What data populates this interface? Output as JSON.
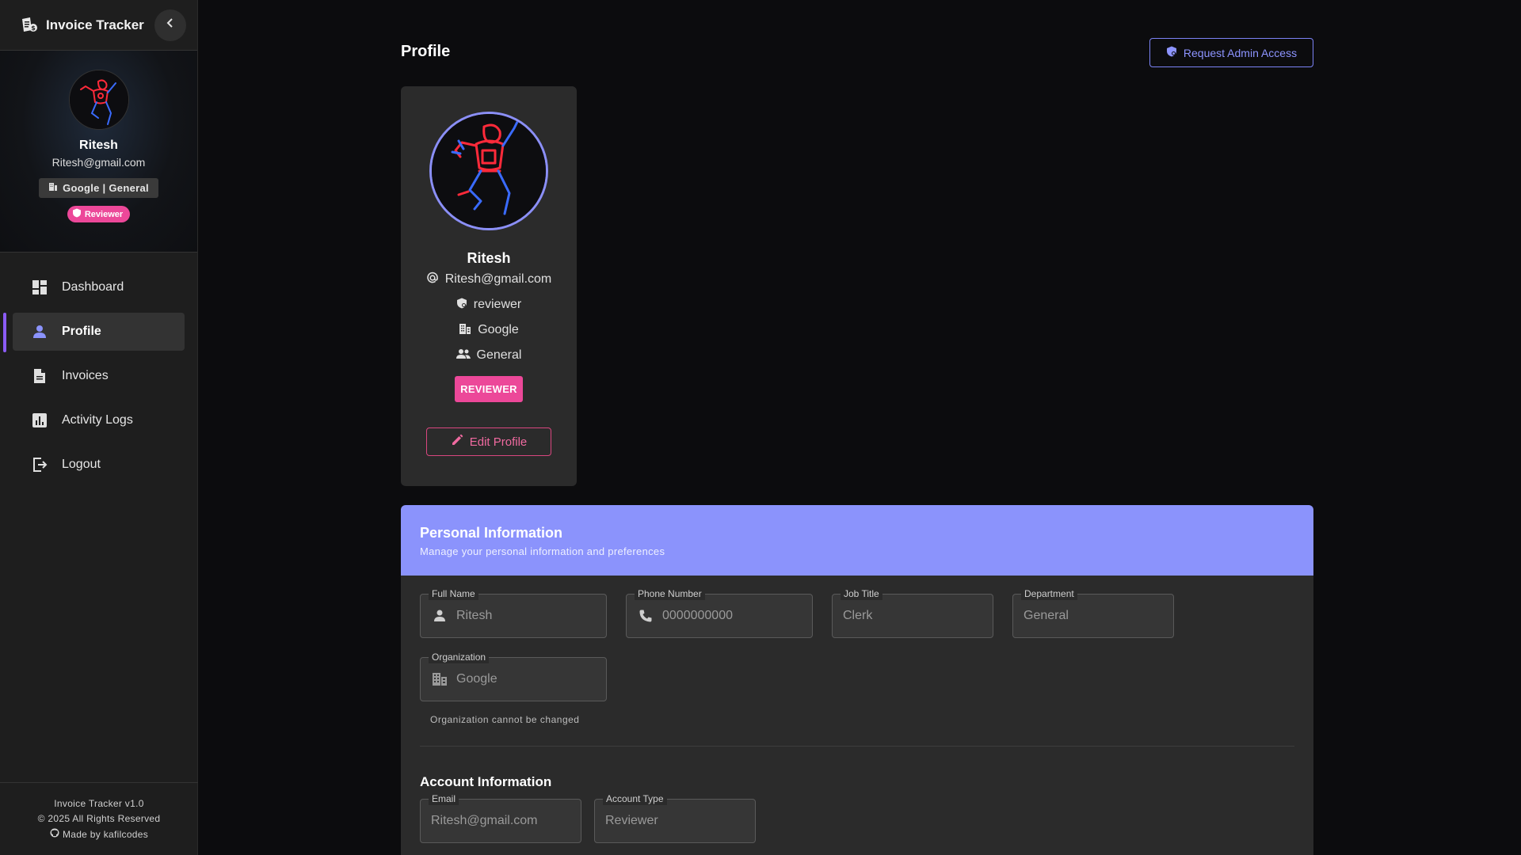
{
  "app": {
    "title": "Invoice Tracker"
  },
  "sidebar": {
    "user": {
      "name": "Ritesh",
      "email": "Ritesh@gmail.com",
      "org_chip": "Google | General",
      "role_chip": "Reviewer"
    },
    "items": [
      {
        "label": "Dashboard",
        "icon": "dashboard-icon"
      },
      {
        "label": "Profile",
        "icon": "person-icon",
        "active": true
      },
      {
        "label": "Invoices",
        "icon": "document-icon"
      },
      {
        "label": "Activity Logs",
        "icon": "bar-chart-icon"
      },
      {
        "label": "Logout",
        "icon": "logout-icon"
      }
    ],
    "footer": {
      "version": "Invoice Tracker v1.0",
      "copyright": "© 2025 All Rights Reserved",
      "made_by": "Made by kafilcodes"
    }
  },
  "main": {
    "title": "Profile",
    "admin_button": "Request Admin Access",
    "profile_card": {
      "name": "Ritesh",
      "email": "Ritesh@gmail.com",
      "role": "reviewer",
      "organization": "Google",
      "department": "General",
      "badge": "REVIEWER",
      "edit_button": "Edit Profile"
    },
    "personal_info": {
      "title": "Personal Information",
      "subtitle": "Manage your personal information and preferences",
      "fields": {
        "full_name": {
          "label": "Full Name",
          "value": "Ritesh"
        },
        "phone": {
          "label": "Phone Number",
          "value": "0000000000"
        },
        "job_title": {
          "label": "Job Title",
          "value": "Clerk"
        },
        "department": {
          "label": "Department",
          "value": "General"
        },
        "organization": {
          "label": "Organization",
          "value": "Google",
          "helper": "Organization cannot be changed"
        }
      }
    },
    "account_info": {
      "title": "Account Information",
      "fields": {
        "email": {
          "label": "Email",
          "value": "Ritesh@gmail.com"
        },
        "account_type": {
          "label": "Account Type",
          "value": "Reviewer"
        }
      }
    }
  },
  "colors": {
    "accent": "#8b93fc",
    "pink": "#ec4899",
    "active_bar": "#8b5cf6",
    "sidebar_bg": "#1e1e1e",
    "panel_bg": "#2b2b2b"
  }
}
